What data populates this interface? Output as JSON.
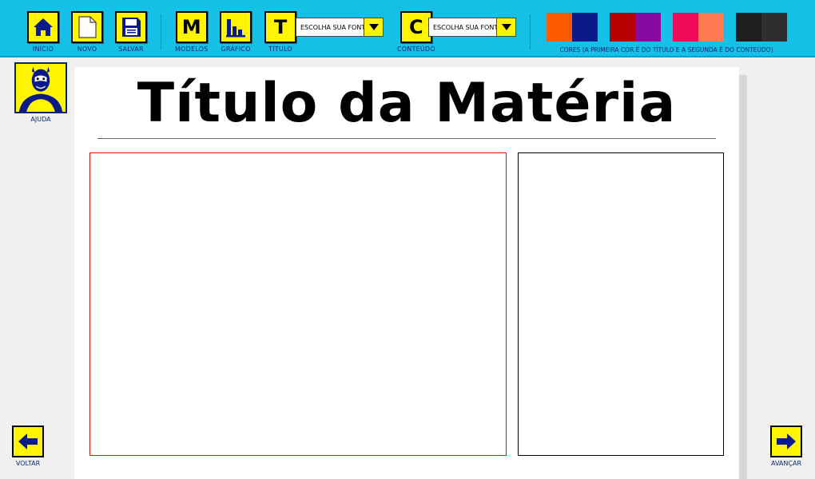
{
  "toolbar": {
    "inicio_label": "INÍCIO",
    "novo_label": "NOVO",
    "salvar_label": "SALVAR",
    "modelos_label": "MODELOS",
    "modelos_letter": "M",
    "grafico_label": "GRÁFICO",
    "titulo_label": "TÍTULO",
    "titulo_letter": "T",
    "titulo_font_select": "ESCOLHA SUA FONTE",
    "conteudo_label": "CONTEÚDO",
    "conteudo_letter": "C",
    "conteudo_font_select": "ESCOLHA SUA FONTE",
    "colors_label": "CORES (A PRIMEIRA COR É DO TÍTULO E A SEGUNDA É DO CONTEÚDO)",
    "color_pairs": [
      {
        "title_color": "#ff5a00",
        "content_color": "#0a1a8a"
      },
      {
        "title_color": "#b80000",
        "content_color": "#880aa0"
      },
      {
        "title_color": "#f00a5a",
        "content_color": "#ff7a50"
      },
      {
        "title_color": "#1e1e1e",
        "content_color": "#2e2e2e"
      }
    ]
  },
  "help": {
    "label": "AJUDA"
  },
  "document": {
    "title": "Título da Matéria"
  },
  "nav": {
    "back_label": "VOLTAR",
    "next_label": "AVANÇAR"
  },
  "colors": {
    "toolbar_bg": "#14c0e6",
    "button_bg": "#fff500",
    "label_text": "#0a2a70",
    "content_border": "#e01010"
  }
}
